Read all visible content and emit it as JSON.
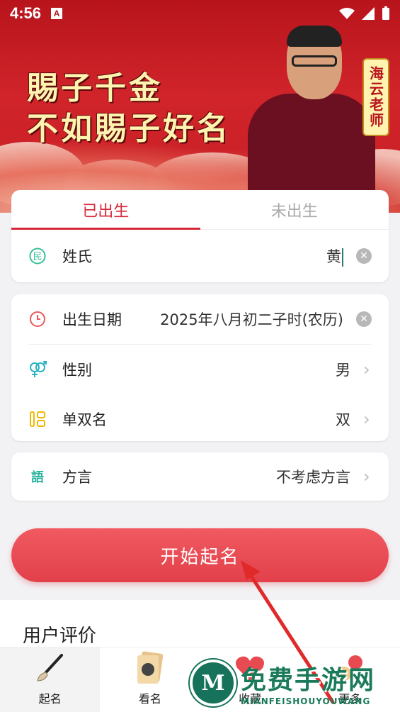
{
  "status_bar": {
    "time": "4:56",
    "notification_letter": "A"
  },
  "banner": {
    "line1": "賜子千金",
    "line2": "不如賜子好名",
    "teacher_tag": "海云老师"
  },
  "birth_tabs": [
    {
      "label": "已出生",
      "active": true
    },
    {
      "label": "未出生",
      "active": false
    }
  ],
  "surname": {
    "icon": "民",
    "label": "姓氏",
    "value": "黄"
  },
  "details": {
    "birth_date": {
      "label": "出生日期",
      "value": "2025年八月初二子时(农历)"
    },
    "gender": {
      "label": "性别",
      "value": "男"
    },
    "name_length": {
      "label": "单双名",
      "value": "双"
    }
  },
  "dialect": {
    "icon": "語",
    "label": "方言",
    "value": "不考虑方言"
  },
  "start_button": "开始起名",
  "reviews": {
    "title": "用户评价"
  },
  "bottom_nav": [
    {
      "label": "起名",
      "icon": "brush-icon",
      "active": true
    },
    {
      "label": "看名",
      "icon": "name-card-icon",
      "active": false
    },
    {
      "label": "收藏",
      "icon": "heart-icon",
      "active": false
    },
    {
      "label": "更多",
      "icon": "more-icon",
      "active": false
    }
  ],
  "watermark": {
    "logo_letter": "M",
    "text": "免费手游网",
    "subtext": "MIANFEISHOUYOUWANG"
  },
  "colors": {
    "accent": "#d6283a",
    "banner": "#c81e25",
    "button": "#e84a52"
  }
}
